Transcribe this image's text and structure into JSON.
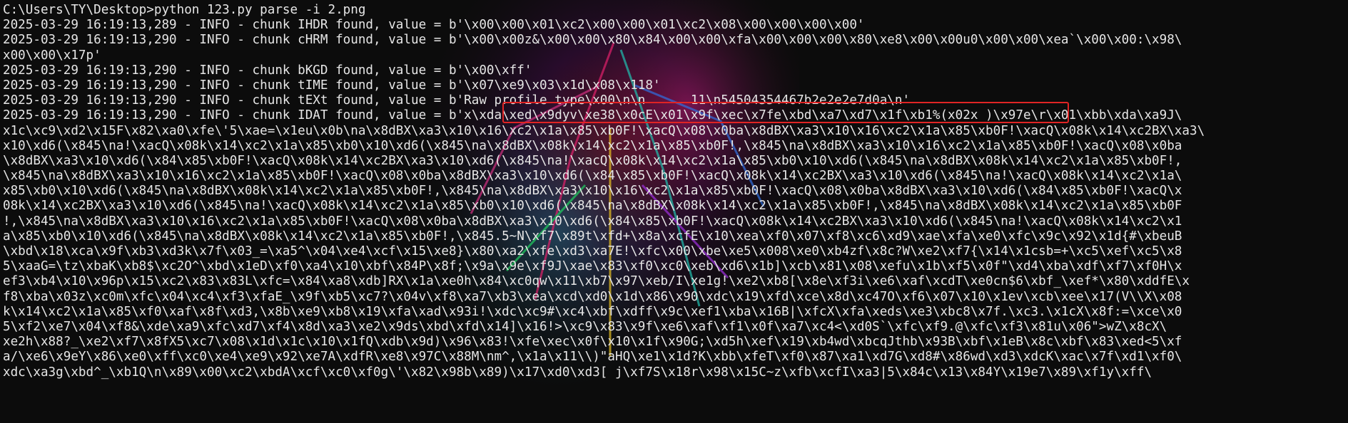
{
  "terminal": {
    "lines": [
      "C:\\Users\\TY\\Desktop>python 123.py parse -i 2.png",
      "2025-03-29 16:19:13,289 - INFO - chunk IHDR found, value = b'\\x00\\x00\\x01\\xc2\\x00\\x00\\x01\\xc2\\x08\\x00\\x00\\x00\\x00'",
      "2025-03-29 16:19:13,290 - INFO - chunk cHRM found, value = b'\\x00\\x00z&\\x00\\x00\\x80\\x84\\x00\\x00\\xfa\\x00\\x00\\x00\\x80\\xe8\\x00\\x00u0\\x00\\x00\\xea`\\x00\\x00:\\x98\\",
      "x00\\x00\\x17p'",
      "2025-03-29 16:19:13,290 - INFO - chunk bKGD found, value = b'\\x00\\xff'",
      "2025-03-29 16:19:13,290 - INFO - chunk tIME found, value = b'\\x07\\xe9\\x03\\x1d\\x08\\x118'",
      "2025-03-29 16:19:13,290 - INFO - chunk tEXt found, value = b'Raw profile type\\x00\\n\\n      11\\n54504354467b2e2e2e7d0a\\n'",
      "2025-03-29 16:19:13,290 - INFO - chunk IDAT found, value = b'x\\xda\\xed\\x9dyv\\xe38\\x0cE\\x01\\x9f\\xec\\x7fe\\xbd\\xa7\\xd7\\x1f\\xb1%(x02x )\\x97e\\r\\x01\\xbb\\xda\\xa9J\\",
      "x1c\\xc9\\xd2\\x15F\\x82\\xa0\\xfe\\'5\\xae=\\x1eu\\x0b\\na\\x8dBX\\xa3\\x10\\x16\\xc2\\x1a\\x85\\xb0F!\\xacQ\\x08\\x0ba\\x8dBX\\xa3\\x10\\x16\\xc2\\x1a\\x85\\xb0F!\\xacQ\\x08k\\x14\\xc2BX\\xa3\\",
      "x10\\xd6(\\x845\\na!\\xacQ\\x08k\\x14\\xc2\\x1a\\x85\\xb0\\x10\\xd6(\\x845\\na\\x8dBX\\x08k\\x14\\xc2\\x1a\\x85\\xb0F!,\\x845\\na\\x8dBX\\xa3\\x10\\x16\\xc2\\x1a\\x85\\xb0F!\\xacQ\\x08\\x0ba",
      "\\x8dBX\\xa3\\x10\\xd6(\\x84\\x85\\xb0F!\\xacQ\\x08k\\x14\\xc2BX\\xa3\\x10\\xd6(\\x845\\na!\\xacQ\\x08k\\x14\\xc2\\x1a\\x85\\xb0\\x10\\xd6(\\x845\\na\\x8dBX\\x08k\\x14\\xc2\\x1a\\x85\\xb0F!,",
      "\\x845\\na\\x8dBX\\xa3\\x10\\x16\\xc2\\x1a\\x85\\xb0F!\\xacQ\\x08\\x0ba\\x8dBX\\xa3\\x10\\xd6(\\x84\\x85\\xb0F!\\xacQ\\x08k\\x14\\xc2BX\\xa3\\x10\\xd6(\\x845\\na!\\xacQ\\x08k\\x14\\xc2\\x1a\\",
      "x85\\xb0\\x10\\xd6(\\x845\\na\\x8dBX\\x08k\\x14\\xc2\\x1a\\x85\\xb0F!,\\x845\\na\\x8dBX\\xa3\\x10\\x16\\xc2\\x1a\\x85\\xb0F!\\xacQ\\x08\\x0ba\\x8dBX\\xa3\\x10\\xd6(\\x84\\x85\\xb0F!\\xacQ\\x",
      "08k\\x14\\xc2BX\\xa3\\x10\\xd6(\\x845\\na!\\xacQ\\x08k\\x14\\xc2\\x1a\\x85\\xb0\\x10\\xd6(\\x845\\na\\x8dBX\\x08k\\x14\\xc2\\x1a\\x85\\xb0F!,\\x845\\na\\x8dBX\\x08k\\x14\\xc2\\x1a\\x85\\xb0F",
      "!,\\x845\\na\\x8dBX\\xa3\\x10\\x16\\xc2\\x1a\\x85\\xb0F!\\xacQ\\x08\\x0ba\\x8dBX\\xa3\\x10\\xd6(\\x84\\x85\\xb0F!\\xacQ\\x08k\\x14\\xc2BX\\xa3\\x10\\xd6(\\x845\\na!\\xacQ\\x08k\\x14\\xc2\\x1",
      "a\\x85\\xb0\\x10\\xd6(\\x845\\na\\x8dBX\\x08k\\x14\\xc2\\x1a\\x85\\xb0F!,\\x845.5~N\\xf7\\x89t\\xfd+\\x8a\\xcfE\\x10\\xea\\xf0\\x07\\xf8\\xc6\\xd9\\xae\\xfa\\xe0\\xfc\\x9c\\x92\\x1d{#\\xbeuB",
      "\\xbd\\x18\\xca\\x9f\\xb3\\xd3k\\x7f\\x03_=\\xa5^\\x04\\xe4\\xcf\\x15\\xe8}\\x80\\xa2\\xfe\\xd3\\xa7E!\\xfc\\x00\\xbe\\xe5\\x008\\xe0\\xb4zf\\x8c?W\\xe2\\xf7{\\x14\\x1csb=+\\xc5\\xef\\xc5\\x8",
      "5\\xaaG=\\tz\\xbaK\\xb8$\\xc2O^\\xbd\\x1eD\\xf0\\xa4\\x10\\xbf\\x84P\\x8f;\\x9a\\x9e\\xf9J\\xae\\x83\\xf0\\xc0\\xeb\\xd6\\x1b]\\xcb\\x81\\x08\\xefu\\x1b\\xf5\\x0f\"\\xd4\\xba\\xdf\\xf7\\xf0H\\x",
      "ef3\\xb4\\x10\\x96p\\x15\\xc2\\x83\\x83L\\xfc=\\x84\\xa8\\xdb]RX\\x1a\\xe0h\\x84\\xc0qw\\x11\\xb7\\x97\\xeb/I\\xe1g!\\xe2\\xb8[\\x8e\\xf3i\\xe6\\xaf\\xcdT\\xe0cn$6\\xbf_\\xef*\\x80\\xddfE\\x",
      "f8\\xba\\x03z\\xc0m\\xfc\\x04\\xc4\\xf3\\xfaE_\\x9f\\xb5\\xc7?\\x04v\\xf8\\xa7\\xb3\\xea\\xcd\\xd0\\x1d\\x86\\x90\\xdc\\x19\\xfd\\xce\\x8d\\xc47O\\xf6\\x07\\x10\\x1ev\\xcb\\xee\\x17(V\\\\X\\x08",
      "k\\x14\\xc2\\x1a\\x85\\xf0\\xaf\\x8f\\xd3,\\x8b\\xe9\\xb8\\x19\\xfa\\xad\\x93i!\\xdc\\xc9#\\xc4\\xbf\\xdff\\x9c\\xef1\\xba\\x16B|\\xfcX\\xfa\\xeds\\xe3\\xbc8\\x7f.\\xc3.\\x1cX\\x8f:=\\xce\\x0",
      "5\\xf2\\xe7\\x04\\xf8&\\xde\\xa9\\xfc\\xd7\\xf4\\x8d\\xa3\\xe2\\x9ds\\xbd\\xfd\\x14]\\x16!>\\xc9\\x83\\x9f\\xe6\\xaf\\xf1\\x0f\\xa7\\xc4<\\xd0S`\\xfc\\xf9.@\\xfc\\xf3\\x81u\\x06\">wZ\\x8cX\\",
      "xe2h\\x88?_\\xe2\\xf7\\x8fX5\\xc7\\x08\\x1d\\x1c\\x10\\x1fQ\\xdb\\x9d)\\x96\\x83!\\xfe\\xec\\x0f\\x10\\x1f\\x90G;\\xd5h\\xef\\x19\\xb4wd\\xbcqJthb\\x93B\\xbf\\x1eB\\x8c\\xbf\\x83\\xed<5\\xf",
      "a/\\xe6\\x9eY\\x86\\xe0\\xff\\xc0\\xe4\\xe9\\x92\\xe7A\\xdfR\\xe8\\x97C\\x88M\\nm^,\\x1a\\x11\\\\)\"aHQ\\xe1\\x1d?K\\xbb\\xfeT\\xf0\\x87\\xa1\\xd7G\\xd8#\\x86wd\\xd3\\xdcK\\xac\\x7f\\xd1\\xf0\\",
      "xdc\\xa3g\\xbd^_\\xb1Q\\n\\x89\\x00\\xc2\\xbdA\\xcf\\xc0\\xf0g\\'\\x82\\x98b\\x89)\\x17\\xd0\\xd3[ j\\xf7S\\x18r\\x98\\x15C~z\\xfb\\xcfI\\xa3|5\\x84c\\x13\\x84Y\\x19e7\\x89\\xf1y\\xff\\"
    ]
  }
}
